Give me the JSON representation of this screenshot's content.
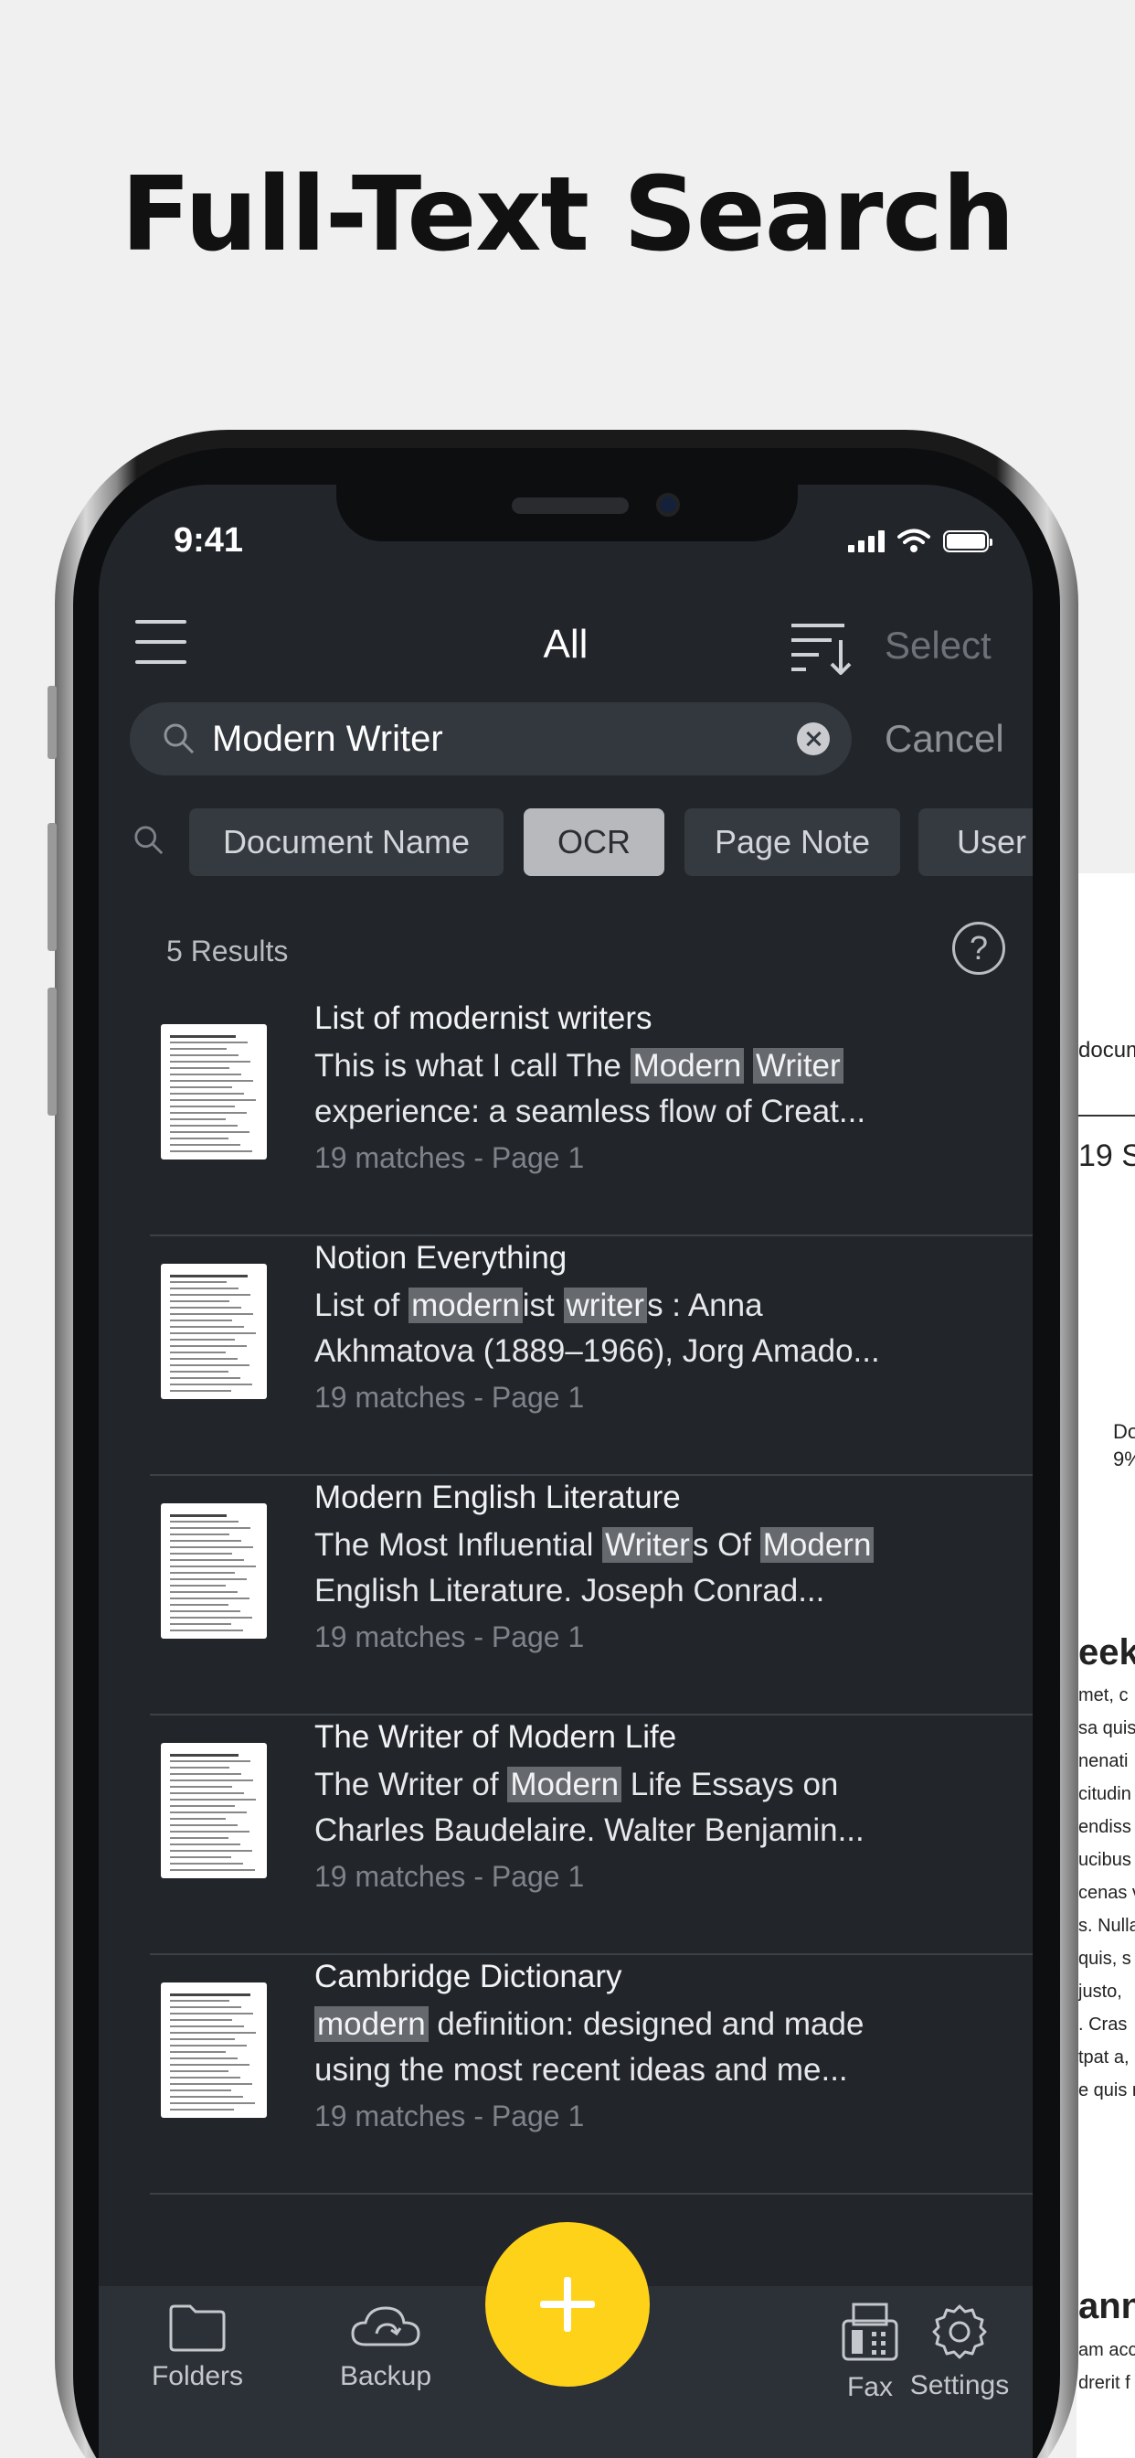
{
  "headline": "Full-Text Search",
  "status_bar": {
    "time": "9:41"
  },
  "nav": {
    "title": "All",
    "select_label": "Select"
  },
  "search": {
    "query": "Modern Writer",
    "cancel_label": "Cancel"
  },
  "filters": [
    {
      "label": "Document Name",
      "active": false
    },
    {
      "label": "OCR",
      "active": true
    },
    {
      "label": "Page Note",
      "active": false
    },
    {
      "label": "User",
      "active": false
    }
  ],
  "results_count": "5 Results",
  "help_label": "?",
  "results": [
    {
      "title": "List of modernist writers",
      "line1": [
        [
          "This is what I call The ",
          false
        ],
        [
          "Modern",
          true
        ],
        [
          " ",
          false
        ],
        [
          "Writer",
          true
        ]
      ],
      "line2": [
        [
          "experience: a seamless flow of Creat...",
          false
        ]
      ],
      "meta": "19 matches - Page 1"
    },
    {
      "title": "Notion Everything",
      "line1": [
        [
          "List of ",
          false
        ],
        [
          "modern",
          true
        ],
        [
          "ist ",
          false
        ],
        [
          "writer",
          true
        ],
        [
          "s : Anna",
          false
        ]
      ],
      "line2": [
        [
          "Akhmatova (1889–1966), Jorg Amado...",
          false
        ]
      ],
      "meta": "19 matches - Page 1"
    },
    {
      "title": "Modern English Literature",
      "line1": [
        [
          "The Most Influential ",
          false
        ],
        [
          "Writer",
          true
        ],
        [
          "s Of ",
          false
        ],
        [
          "Modern",
          true
        ]
      ],
      "line2": [
        [
          "English Literature. Joseph Conrad...",
          false
        ]
      ],
      "meta": "19 matches - Page 1"
    },
    {
      "title": "The Writer of Modern Life",
      "line1": [
        [
          "The Writer of ",
          false
        ],
        [
          "Modern",
          true
        ],
        [
          " Life Essays on",
          false
        ]
      ],
      "line2": [
        [
          "Charles Baudelaire. Walter Benjamin...",
          false
        ]
      ],
      "meta": "19 matches - Page 1"
    },
    {
      "title": "Cambridge Dictionary",
      "line1": [
        [
          "modern",
          true
        ],
        [
          " definition: designed and made",
          false
        ]
      ],
      "line2": [
        [
          "using the most recent ideas and me...",
          false
        ]
      ],
      "meta": "19 matches - Page 1"
    }
  ],
  "tabbar": {
    "folders": "Folders",
    "backup": "Backup",
    "fax": "Fax",
    "settings": "Settings"
  },
  "background_doc": {
    "snippets": [
      "docum",
      "19 S",
      "Do",
      "9%",
      "eek",
      "met, c",
      "sa quis",
      "nenati",
      "citudin",
      "endiss",
      "ucibus",
      "cenas v",
      "s. Nulla",
      "quis, s",
      "justo,",
      ". Cras",
      "tpat a,",
      "e quis n",
      "ann",
      "am acc",
      "drerit f"
    ]
  },
  "colors": {
    "accent": "#ffd21a",
    "background": "#22262b",
    "highlight": "#666a6f"
  }
}
